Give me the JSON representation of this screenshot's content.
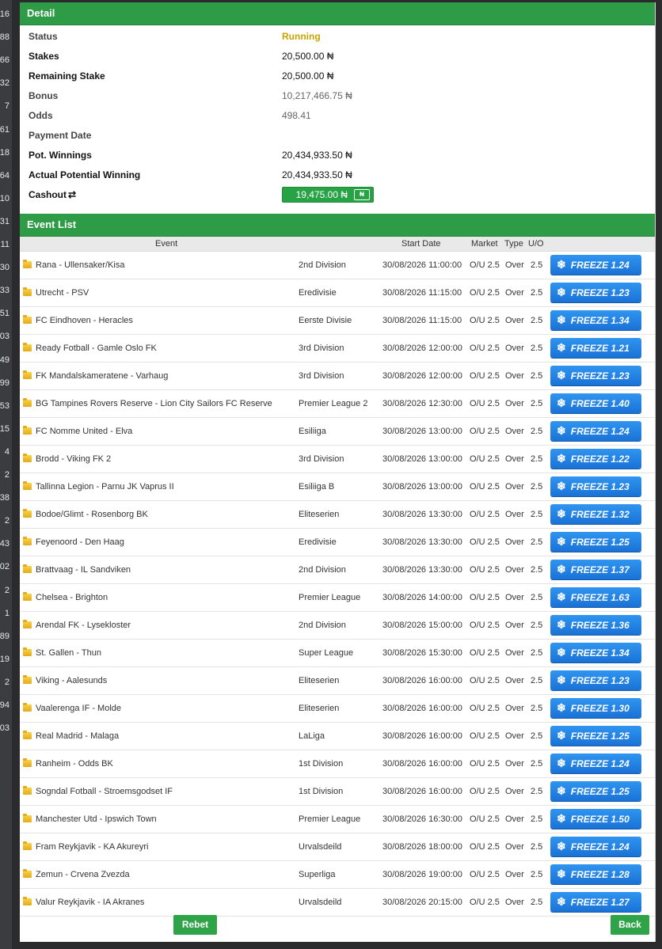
{
  "edge_numbers": [
    "16",
    "88",
    "66",
    "32",
    "7",
    "61",
    "18",
    "64",
    "10",
    "31",
    "11",
    "30",
    "33",
    "51",
    "03",
    "49",
    "99",
    "53",
    "15",
    "4",
    "2",
    "38",
    "2",
    "43",
    "02",
    "2",
    "1",
    "89",
    "19",
    "2",
    "94",
    "03"
  ],
  "detail": {
    "title": "Detail",
    "rows": [
      {
        "label": "Status",
        "value": "Running"
      },
      {
        "label": "Stakes",
        "value": "20,500.00 ₦"
      },
      {
        "label": "Remaining Stake",
        "value": "20,500.00 ₦"
      },
      {
        "label": "Bonus",
        "value": "10,217,466.75 ₦"
      },
      {
        "label": "Odds",
        "value": "498.41"
      },
      {
        "label": "Payment Date",
        "value": ""
      },
      {
        "label": "Pot. Winnings",
        "value": "20,434,933.50 ₦"
      },
      {
        "label": "Actual Potential Winning",
        "value": "20,434,933.50 ₦"
      }
    ],
    "cashout_label": "Cashout",
    "cashout_value": "19,475.00 ₦",
    "cashout_icon": "banknote-icon",
    "status_color": "#c9a400"
  },
  "events": {
    "title": "Event List",
    "columns": {
      "event": "Event",
      "start": "Start Date",
      "market": "Market",
      "type": "Type",
      "uo": "U/O"
    },
    "rows": [
      {
        "event": "Rana - Ullensaker/Kisa",
        "league": "2nd Division",
        "date": "30/08/2026 11:00:00",
        "market": "O/U 2.5",
        "type": "Over",
        "uo": "2.5",
        "freeze": "FREEZE 1.24"
      },
      {
        "event": "Utrecht - PSV",
        "league": "Eredivisie",
        "date": "30/08/2026 11:15:00",
        "market": "O/U 2.5",
        "type": "Over",
        "uo": "2.5",
        "freeze": "FREEZE 1.23"
      },
      {
        "event": "FC Eindhoven - Heracles",
        "league": "Eerste Divisie",
        "date": "30/08/2026 11:15:00",
        "market": "O/U 2.5",
        "type": "Over",
        "uo": "2.5",
        "freeze": "FREEZE 1.34"
      },
      {
        "event": "Ready Fotball - Gamle Oslo FK",
        "league": "3rd Division",
        "date": "30/08/2026 12:00:00",
        "market": "O/U 2.5",
        "type": "Over",
        "uo": "2.5",
        "freeze": "FREEZE 1.21"
      },
      {
        "event": "FK Mandalskameratene - Varhaug",
        "league": "3rd Division",
        "date": "30/08/2026 12:00:00",
        "market": "O/U 2.5",
        "type": "Over",
        "uo": "2.5",
        "freeze": "FREEZE 1.23"
      },
      {
        "event": "BG Tampines Rovers Reserve - Lion City Sailors FC Reserve",
        "league": "Premier League 2",
        "date": "30/08/2026 12:30:00",
        "market": "O/U 2.5",
        "type": "Over",
        "uo": "2.5",
        "freeze": "FREEZE 1.40"
      },
      {
        "event": "FC Nomme United - Elva",
        "league": "Esiliiga",
        "date": "30/08/2026 13:00:00",
        "market": "O/U 2.5",
        "type": "Over",
        "uo": "2.5",
        "freeze": "FREEZE 1.24"
      },
      {
        "event": "Brodd - Viking FK 2",
        "league": "3rd Division",
        "date": "30/08/2026 13:00:00",
        "market": "O/U 2.5",
        "type": "Over",
        "uo": "2.5",
        "freeze": "FREEZE 1.22"
      },
      {
        "event": "Tallinna Legion - Parnu JK Vaprus II",
        "league": "Esiliiga B",
        "date": "30/08/2026 13:00:00",
        "market": "O/U 2.5",
        "type": "Over",
        "uo": "2.5",
        "freeze": "FREEZE 1.23"
      },
      {
        "event": "Bodoe/Glimt - Rosenborg BK",
        "league": "Eliteserien",
        "date": "30/08/2026 13:30:00",
        "market": "O/U 2.5",
        "type": "Over",
        "uo": "2.5",
        "freeze": "FREEZE 1.32"
      },
      {
        "event": "Feyenoord - Den Haag",
        "league": "Eredivisie",
        "date": "30/08/2026 13:30:00",
        "market": "O/U 2.5",
        "type": "Over",
        "uo": "2.5",
        "freeze": "FREEZE 1.25"
      },
      {
        "event": "Brattvaag - IL Sandviken",
        "league": "2nd Division",
        "date": "30/08/2026 13:30:00",
        "market": "O/U 2.5",
        "type": "Over",
        "uo": "2.5",
        "freeze": "FREEZE 1.37"
      },
      {
        "event": "Chelsea - Brighton",
        "league": "Premier League",
        "date": "30/08/2026 14:00:00",
        "market": "O/U 2.5",
        "type": "Over",
        "uo": "2.5",
        "freeze": "FREEZE 1.63"
      },
      {
        "event": "Arendal FK - Lysekloster",
        "league": "2nd Division",
        "date": "30/08/2026 15:00:00",
        "market": "O/U 2.5",
        "type": "Over",
        "uo": "2.5",
        "freeze": "FREEZE 1.36"
      },
      {
        "event": "St. Gallen - Thun",
        "league": "Super League",
        "date": "30/08/2026 15:30:00",
        "market": "O/U 2.5",
        "type": "Over",
        "uo": "2.5",
        "freeze": "FREEZE 1.34"
      },
      {
        "event": "Viking - Aalesunds",
        "league": "Eliteserien",
        "date": "30/08/2026 16:00:00",
        "market": "O/U 2.5",
        "type": "Over",
        "uo": "2.5",
        "freeze": "FREEZE 1.23"
      },
      {
        "event": "Vaalerenga IF - Molde",
        "league": "Eliteserien",
        "date": "30/08/2026 16:00:00",
        "market": "O/U 2.5",
        "type": "Over",
        "uo": "2.5",
        "freeze": "FREEZE 1.30"
      },
      {
        "event": "Real Madrid - Malaga",
        "league": "LaLiga",
        "date": "30/08/2026 16:00:00",
        "market": "O/U 2.5",
        "type": "Over",
        "uo": "2.5",
        "freeze": "FREEZE 1.25"
      },
      {
        "event": "Ranheim - Odds BK",
        "league": "1st Division",
        "date": "30/08/2026 16:00:00",
        "market": "O/U 2.5",
        "type": "Over",
        "uo": "2.5",
        "freeze": "FREEZE 1.24"
      },
      {
        "event": "Sogndal Fotball - Stroemsgodset IF",
        "league": "1st Division",
        "date": "30/08/2026 16:00:00",
        "market": "O/U 2.5",
        "type": "Over",
        "uo": "2.5",
        "freeze": "FREEZE 1.25"
      },
      {
        "event": "Manchester Utd - Ipswich Town",
        "league": "Premier League",
        "date": "30/08/2026 16:30:00",
        "market": "O/U 2.5",
        "type": "Over",
        "uo": "2.5",
        "freeze": "FREEZE 1.50"
      },
      {
        "event": "Fram Reykjavik - KA Akureyri",
        "league": "Urvalsdeild",
        "date": "30/08/2026 18:00:00",
        "market": "O/U 2.5",
        "type": "Over",
        "uo": "2.5",
        "freeze": "FREEZE 1.24"
      },
      {
        "event": "Zemun - Crvena Zvezda",
        "league": "Superliga",
        "date": "30/08/2026 19:00:00",
        "market": "O/U 2.5",
        "type": "Over",
        "uo": "2.5",
        "freeze": "FREEZE 1.28"
      },
      {
        "event": "Valur Reykjavik - IA Akranes",
        "league": "Urvalsdeild",
        "date": "30/08/2026 20:15:00",
        "market": "O/U 2.5",
        "type": "Over",
        "uo": "2.5",
        "freeze": "FREEZE 1.27"
      }
    ]
  },
  "footer": {
    "rebet": "Rebet",
    "back": "Back"
  },
  "colors": {
    "header_green": "#2e9c47",
    "freeze_blue": "#1a72d6",
    "running": "#c9a400"
  }
}
